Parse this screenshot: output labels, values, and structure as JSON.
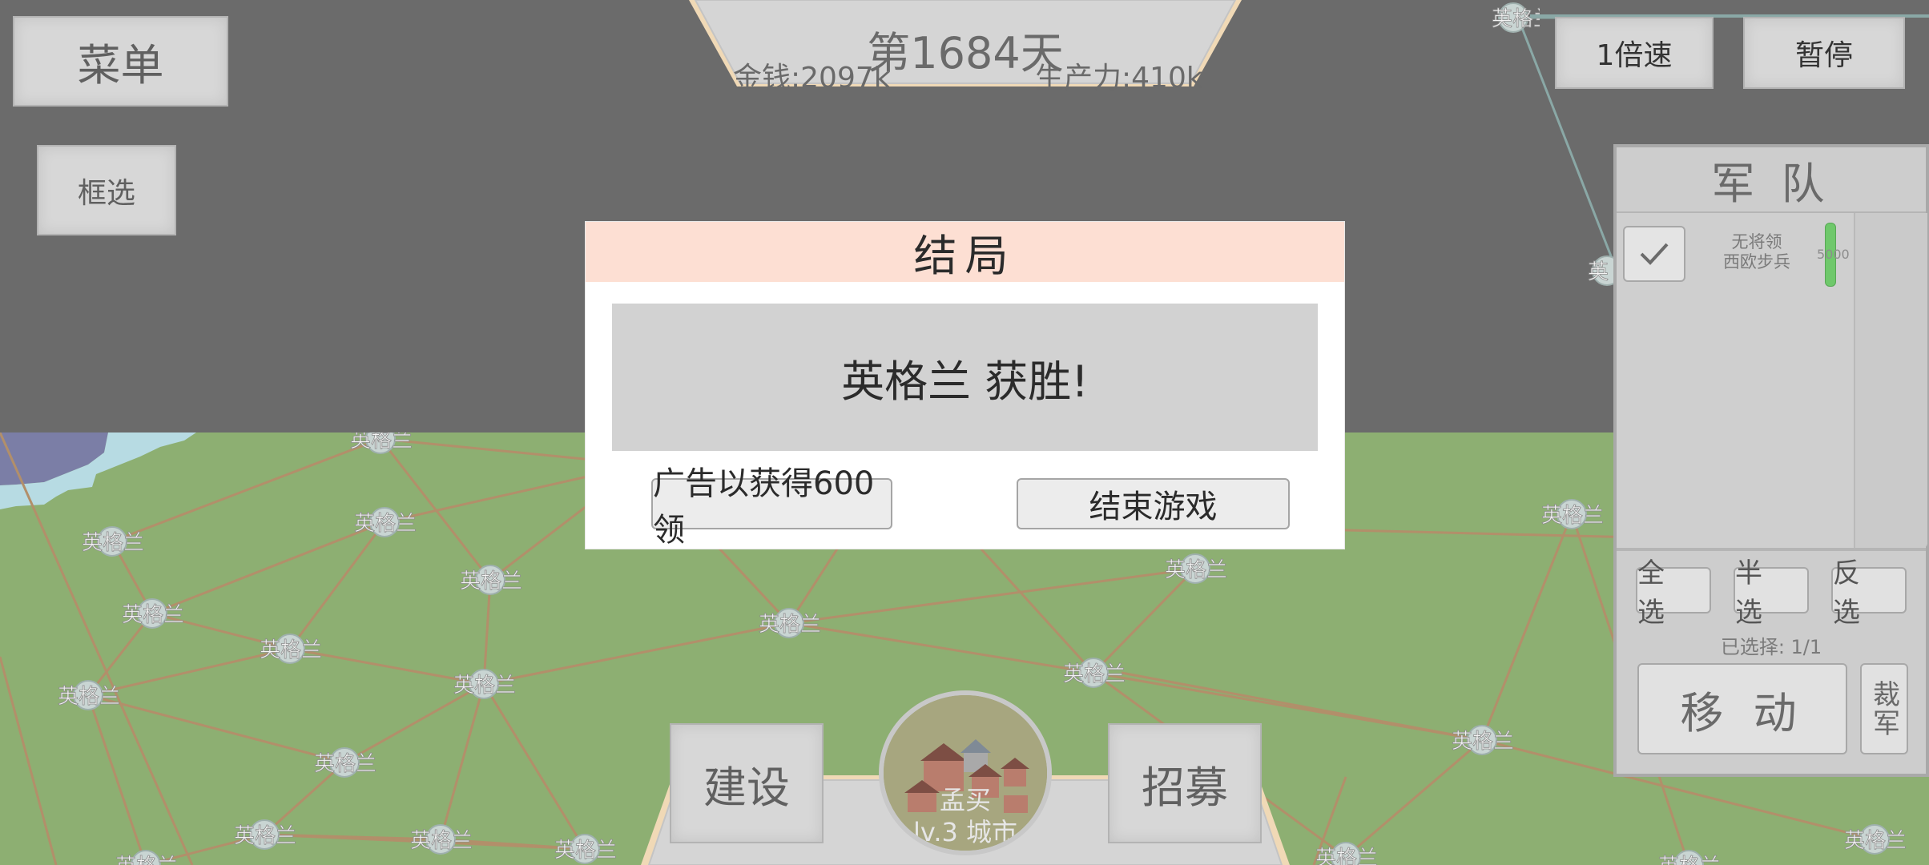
{
  "top": {
    "day": "第1684天",
    "money": "金钱:2097k",
    "production": "生产力:410k"
  },
  "buttons": {
    "menu": "菜单",
    "box_select": "框选",
    "speed": "1倍速",
    "pause": "暂停",
    "build": "建设",
    "recruit": "招募"
  },
  "city": {
    "name": "孟买",
    "level": "lv.3 城市"
  },
  "dialog": {
    "title": "结局",
    "message": "英格兰 获胜!",
    "ad_button": "广告以获得600领",
    "end_button": "结束游戏"
  },
  "army_panel": {
    "title": "军 队",
    "unit_general": "无将领",
    "unit_type": "西欧步兵",
    "unit_count": "5000",
    "select_all": "全 选",
    "select_half": "半 选",
    "select_invert": "反 选",
    "selected": "已选择: 1/1",
    "move": "移 动",
    "disband": "裁军"
  },
  "map": {
    "node_name": "英格兰",
    "colors": {
      "grass": "#8daf72",
      "water_deep": "#7b7ea6",
      "water_shallow": "#b7dbe3",
      "road": "#b28f6a",
      "route_line": "#8aa8a6"
    }
  }
}
